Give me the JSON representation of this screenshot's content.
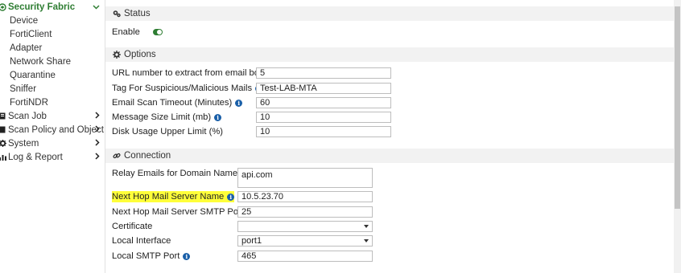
{
  "sidebar": {
    "security_fabric": "Security Fabric",
    "sub_items": [
      "Device",
      "FortiClient",
      "Adapter",
      "Network Share",
      "Quarantine",
      "Sniffer",
      "FortiNDR"
    ],
    "top_items": [
      {
        "label": "Scan Job",
        "icon": "scan-icon"
      },
      {
        "label": "Scan Policy and Object",
        "icon": "policy-icon"
      },
      {
        "label": "System",
        "icon": "gear-icon"
      },
      {
        "label": "Log & Report",
        "icon": "chart-icon"
      }
    ]
  },
  "status": {
    "header": "Status",
    "enable_label": "Enable",
    "enabled": true,
    "toggle_color": "#2e7d32"
  },
  "options": {
    "header": "Options",
    "fields": [
      {
        "label": "URL number to extract from email body",
        "value": "5"
      },
      {
        "label": "Tag For Suspicious/Malicious Mails",
        "value": "Test-LAB-MTA"
      },
      {
        "label": "Email Scan Timeout (Minutes)",
        "value": "60"
      },
      {
        "label": "Message Size Limit (mb)",
        "value": "10"
      },
      {
        "label": "Disk Usage Upper Limit (%)",
        "value": "10"
      }
    ]
  },
  "connection": {
    "header": "Connection",
    "relay_label": "Relay Emails for Domain Names",
    "relay_value": "api.com",
    "next_hop_name_label": "Next Hop Mail Server Name",
    "next_hop_name_value": "10.5.23.70",
    "next_hop_port_label": "Next Hop Mail Server SMTP Port",
    "next_hop_port_value": "25",
    "certificate_label": "Certificate",
    "certificate_value": "",
    "local_interface_label": "Local Interface",
    "local_interface_value": "port1",
    "local_smtp_label": "Local SMTP Port",
    "local_smtp_value": "465",
    "highlight_color": "#ffff3a"
  }
}
